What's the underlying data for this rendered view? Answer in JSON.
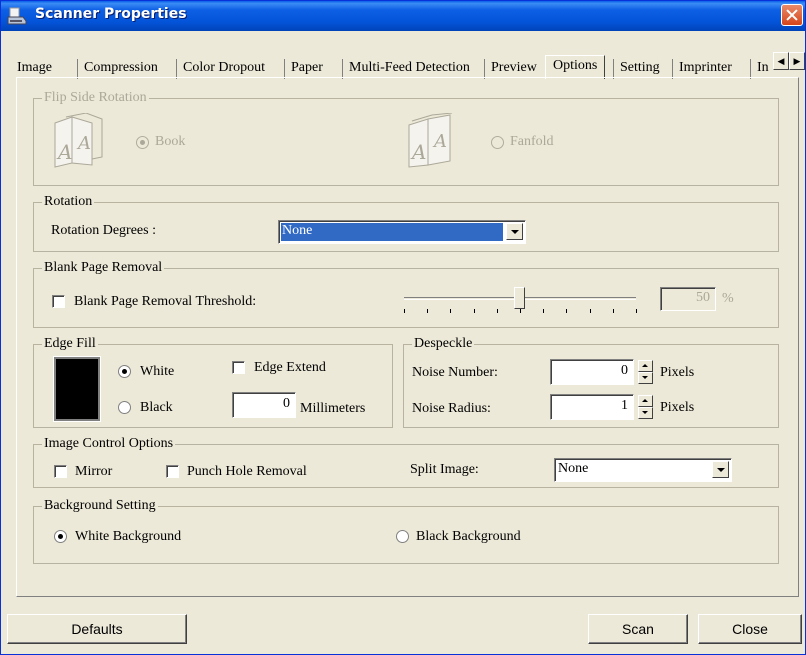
{
  "window": {
    "title": "Scanner Properties"
  },
  "tabs": [
    "Image",
    "Compression",
    "Color Dropout",
    "Paper",
    "Multi-Feed Detection",
    "Preview",
    "Options",
    "Setting",
    "Imprinter",
    "In"
  ],
  "active_tab": "Options",
  "flip_side_rotation": {
    "title": "Flip Side Rotation",
    "book_label": "Book",
    "fanfold_label": "Fanfold",
    "selected": "Book"
  },
  "rotation": {
    "title": "Rotation",
    "degrees_label": "Rotation Degrees :",
    "degrees_value": "None"
  },
  "blank_page_removal": {
    "title": "Blank Page Removal",
    "threshold_label": "Blank Page Removal Threshold:",
    "checked": false,
    "threshold_value": "50",
    "threshold_unit": "%",
    "slider_fraction": 0.5
  },
  "edge_fill": {
    "title": "Edge Fill",
    "white_label": "White",
    "black_label": "Black",
    "selected": "White",
    "edge_extend_label": "Edge Extend",
    "edge_extend_checked": false,
    "millimeters_value": "0",
    "millimeters_unit": "Millimeters",
    "swatch_color": "#000000"
  },
  "despeckle": {
    "title": "Despeckle",
    "noise_number_label": "Noise Number:",
    "noise_number_value": "0",
    "noise_radius_label": "Noise Radius:",
    "noise_radius_value": "1",
    "unit": "Pixels"
  },
  "image_control": {
    "title": "Image Control Options",
    "mirror_label": "Mirror",
    "punch_hole_label": "Punch Hole Removal",
    "split_image_label": "Split Image:",
    "split_image_value": "None"
  },
  "background": {
    "title": "Background Setting",
    "white_label": "White Background",
    "black_label": "Black Background",
    "selected": "White Background"
  },
  "buttons": {
    "defaults": "Defaults",
    "scan": "Scan",
    "close": "Close"
  },
  "colors": {
    "titlebar": "#0454d9",
    "selection": "#316ac5",
    "close_button": "#d6451a"
  },
  "icons": {
    "title_icon": "scanner-icon",
    "book_icon": "book-pages-icon",
    "fanfold_icon": "fanfold-pages-icon"
  }
}
